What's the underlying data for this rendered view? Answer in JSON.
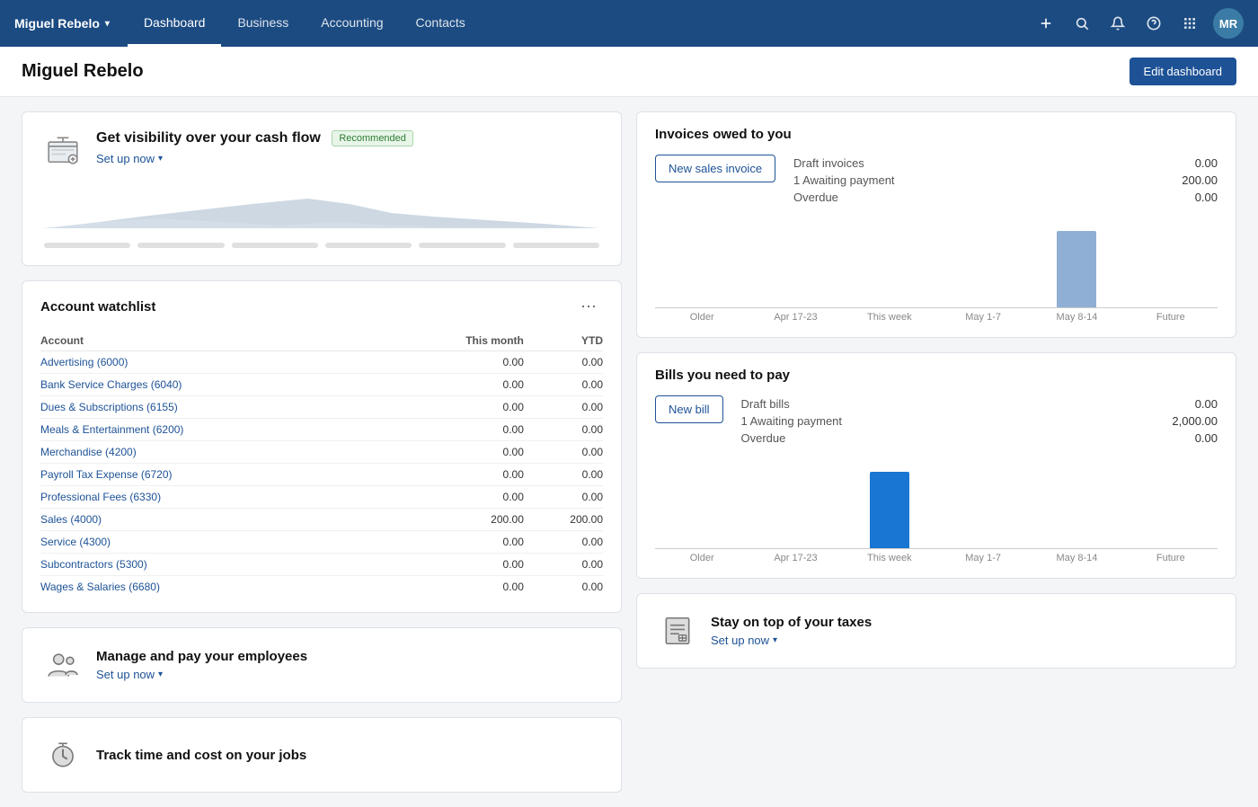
{
  "nav": {
    "brand": "Miguel Rebelo",
    "chevron": "▾",
    "links": [
      {
        "label": "Dashboard",
        "active": true
      },
      {
        "label": "Business",
        "active": false
      },
      {
        "label": "Accounting",
        "active": false
      },
      {
        "label": "Contacts",
        "active": false
      }
    ],
    "actions": {
      "plus": "+",
      "search": "🔍",
      "bell": "🔔",
      "help": "?",
      "grid": "⋮⋮",
      "avatar": "MR"
    }
  },
  "header": {
    "title": "Miguel Rebelo",
    "edit_btn": "Edit dashboard"
  },
  "cashflow": {
    "title": "Get visibility over your cash flow",
    "badge": "Recommended",
    "setup": "Set up now"
  },
  "watchlist": {
    "title": "Account watchlist",
    "col_month": "This month",
    "col_ytd": "YTD",
    "col_account": "Account",
    "rows": [
      {
        "account": "Advertising (6000)",
        "month": "0.00",
        "ytd": "0.00"
      },
      {
        "account": "Bank Service Charges (6040)",
        "month": "0.00",
        "ytd": "0.00"
      },
      {
        "account": "Dues & Subscriptions (6155)",
        "month": "0.00",
        "ytd": "0.00"
      },
      {
        "account": "Meals & Entertainment (6200)",
        "month": "0.00",
        "ytd": "0.00"
      },
      {
        "account": "Merchandise (4200)",
        "month": "0.00",
        "ytd": "0.00"
      },
      {
        "account": "Payroll Tax Expense (6720)",
        "month": "0.00",
        "ytd": "0.00"
      },
      {
        "account": "Professional Fees (6330)",
        "month": "0.00",
        "ytd": "0.00"
      },
      {
        "account": "Sales (4000)",
        "month": "200.00",
        "ytd": "200.00"
      },
      {
        "account": "Service (4300)",
        "month": "0.00",
        "ytd": "0.00"
      },
      {
        "account": "Subcontractors (5300)",
        "month": "0.00",
        "ytd": "0.00"
      },
      {
        "account": "Wages & Salaries (6680)",
        "month": "0.00",
        "ytd": "0.00"
      }
    ]
  },
  "employees": {
    "title": "Manage and pay your employees",
    "setup": "Set up now"
  },
  "track": {
    "title": "Track time and cost on your jobs"
  },
  "invoices": {
    "title": "Invoices owed to you",
    "new_btn": "New sales invoice",
    "stats": [
      {
        "label": "Draft invoices",
        "value": "0.00",
        "orange": false
      },
      {
        "label": "1 Awaiting payment",
        "value": "200.00",
        "orange": false
      },
      {
        "label": "Overdue",
        "value": "0.00",
        "orange": false
      }
    ],
    "chart": {
      "bars": [
        {
          "label": "Older",
          "height": 0,
          "color": "#b0bec5"
        },
        {
          "label": "Apr 17-23",
          "height": 0,
          "color": "#b0bec5"
        },
        {
          "label": "This week",
          "height": 0,
          "color": "#b0bec5"
        },
        {
          "label": "May 1-7",
          "height": 0,
          "color": "#b0bec5"
        },
        {
          "label": "May 8-14",
          "height": 85,
          "color": "#90afd4"
        },
        {
          "label": "Future",
          "height": 0,
          "color": "#b0bec5"
        }
      ]
    }
  },
  "bills": {
    "title": "Bills you need to pay",
    "new_btn": "New bill",
    "stats": [
      {
        "label": "Draft bills",
        "value": "0.00"
      },
      {
        "label": "1 Awaiting payment",
        "value": "2,000.00"
      },
      {
        "label": "Overdue",
        "value": "0.00"
      }
    ],
    "chart": {
      "bars": [
        {
          "label": "Older",
          "height": 0,
          "color": "#b0bec5"
        },
        {
          "label": "Apr 17-23",
          "height": 0,
          "color": "#b0bec5"
        },
        {
          "label": "This week",
          "height": 85,
          "color": "#1976d2"
        },
        {
          "label": "May 1-7",
          "height": 0,
          "color": "#b0bec5"
        },
        {
          "label": "May 8-14",
          "height": 0,
          "color": "#b0bec5"
        },
        {
          "label": "Future",
          "height": 0,
          "color": "#b0bec5"
        }
      ]
    }
  },
  "taxes": {
    "title": "Stay on top of your taxes",
    "setup": "Set up now"
  }
}
